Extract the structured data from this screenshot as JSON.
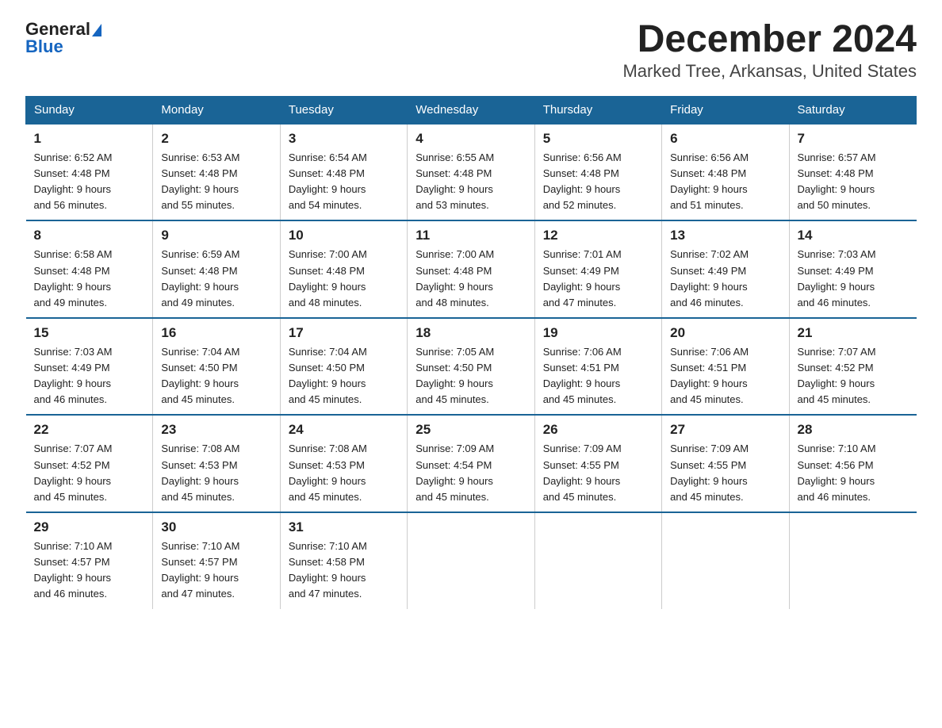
{
  "header": {
    "logo_general": "General",
    "logo_blue": "Blue",
    "title": "December 2024",
    "subtitle": "Marked Tree, Arkansas, United States"
  },
  "days_of_week": [
    "Sunday",
    "Monday",
    "Tuesday",
    "Wednesday",
    "Thursday",
    "Friday",
    "Saturday"
  ],
  "weeks": [
    [
      {
        "day": "1",
        "sunrise": "6:52 AM",
        "sunset": "4:48 PM",
        "daylight": "9 hours and 56 minutes."
      },
      {
        "day": "2",
        "sunrise": "6:53 AM",
        "sunset": "4:48 PM",
        "daylight": "9 hours and 55 minutes."
      },
      {
        "day": "3",
        "sunrise": "6:54 AM",
        "sunset": "4:48 PM",
        "daylight": "9 hours and 54 minutes."
      },
      {
        "day": "4",
        "sunrise": "6:55 AM",
        "sunset": "4:48 PM",
        "daylight": "9 hours and 53 minutes."
      },
      {
        "day": "5",
        "sunrise": "6:56 AM",
        "sunset": "4:48 PM",
        "daylight": "9 hours and 52 minutes."
      },
      {
        "day": "6",
        "sunrise": "6:56 AM",
        "sunset": "4:48 PM",
        "daylight": "9 hours and 51 minutes."
      },
      {
        "day": "7",
        "sunrise": "6:57 AM",
        "sunset": "4:48 PM",
        "daylight": "9 hours and 50 minutes."
      }
    ],
    [
      {
        "day": "8",
        "sunrise": "6:58 AM",
        "sunset": "4:48 PM",
        "daylight": "9 hours and 49 minutes."
      },
      {
        "day": "9",
        "sunrise": "6:59 AM",
        "sunset": "4:48 PM",
        "daylight": "9 hours and 49 minutes."
      },
      {
        "day": "10",
        "sunrise": "7:00 AM",
        "sunset": "4:48 PM",
        "daylight": "9 hours and 48 minutes."
      },
      {
        "day": "11",
        "sunrise": "7:00 AM",
        "sunset": "4:48 PM",
        "daylight": "9 hours and 48 minutes."
      },
      {
        "day": "12",
        "sunrise": "7:01 AM",
        "sunset": "4:49 PM",
        "daylight": "9 hours and 47 minutes."
      },
      {
        "day": "13",
        "sunrise": "7:02 AM",
        "sunset": "4:49 PM",
        "daylight": "9 hours and 46 minutes."
      },
      {
        "day": "14",
        "sunrise": "7:03 AM",
        "sunset": "4:49 PM",
        "daylight": "9 hours and 46 minutes."
      }
    ],
    [
      {
        "day": "15",
        "sunrise": "7:03 AM",
        "sunset": "4:49 PM",
        "daylight": "9 hours and 46 minutes."
      },
      {
        "day": "16",
        "sunrise": "7:04 AM",
        "sunset": "4:50 PM",
        "daylight": "9 hours and 45 minutes."
      },
      {
        "day": "17",
        "sunrise": "7:04 AM",
        "sunset": "4:50 PM",
        "daylight": "9 hours and 45 minutes."
      },
      {
        "day": "18",
        "sunrise": "7:05 AM",
        "sunset": "4:50 PM",
        "daylight": "9 hours and 45 minutes."
      },
      {
        "day": "19",
        "sunrise": "7:06 AM",
        "sunset": "4:51 PM",
        "daylight": "9 hours and 45 minutes."
      },
      {
        "day": "20",
        "sunrise": "7:06 AM",
        "sunset": "4:51 PM",
        "daylight": "9 hours and 45 minutes."
      },
      {
        "day": "21",
        "sunrise": "7:07 AM",
        "sunset": "4:52 PM",
        "daylight": "9 hours and 45 minutes."
      }
    ],
    [
      {
        "day": "22",
        "sunrise": "7:07 AM",
        "sunset": "4:52 PM",
        "daylight": "9 hours and 45 minutes."
      },
      {
        "day": "23",
        "sunrise": "7:08 AM",
        "sunset": "4:53 PM",
        "daylight": "9 hours and 45 minutes."
      },
      {
        "day": "24",
        "sunrise": "7:08 AM",
        "sunset": "4:53 PM",
        "daylight": "9 hours and 45 minutes."
      },
      {
        "day": "25",
        "sunrise": "7:09 AM",
        "sunset": "4:54 PM",
        "daylight": "9 hours and 45 minutes."
      },
      {
        "day": "26",
        "sunrise": "7:09 AM",
        "sunset": "4:55 PM",
        "daylight": "9 hours and 45 minutes."
      },
      {
        "day": "27",
        "sunrise": "7:09 AM",
        "sunset": "4:55 PM",
        "daylight": "9 hours and 45 minutes."
      },
      {
        "day": "28",
        "sunrise": "7:10 AM",
        "sunset": "4:56 PM",
        "daylight": "9 hours and 46 minutes."
      }
    ],
    [
      {
        "day": "29",
        "sunrise": "7:10 AM",
        "sunset": "4:57 PM",
        "daylight": "9 hours and 46 minutes."
      },
      {
        "day": "30",
        "sunrise": "7:10 AM",
        "sunset": "4:57 PM",
        "daylight": "9 hours and 47 minutes."
      },
      {
        "day": "31",
        "sunrise": "7:10 AM",
        "sunset": "4:58 PM",
        "daylight": "9 hours and 47 minutes."
      },
      null,
      null,
      null,
      null
    ]
  ],
  "labels": {
    "sunrise": "Sunrise:",
    "sunset": "Sunset:",
    "daylight": "Daylight:"
  }
}
